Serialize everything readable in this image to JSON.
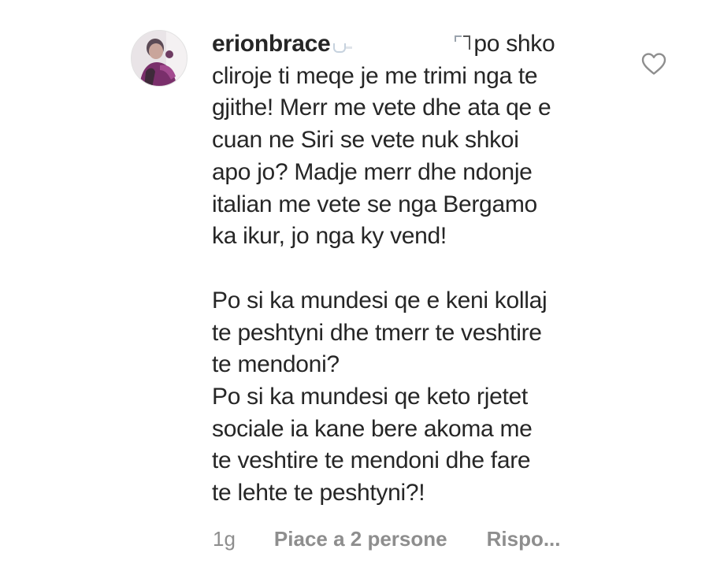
{
  "comment": {
    "username": "erionbrace",
    "mention_tail": "po shko",
    "paragraph1": "cliroje ti meqe je me trimi nga te\ngjithe! Merr me vete dhe ata qe e\ncuan ne Siri se vete nuk shkoi\napo jo? Madje merr dhe ndonje\nitalian me vete se nga Bergamo\nka ikur, jo nga ky vend!",
    "paragraph2": "Po si ka mundesi qe e keni kollaj\nte peshtyni dhe tmerr te veshtire\nte mendoni?\nPo si ka mundesi qe keto rjetet\nsociale ia kane bere akoma me\nte veshtire te mendoni dhe fare\nte lehte te peshtyni?!"
  },
  "meta": {
    "time": "1g",
    "likes": "Piace a 2 persone",
    "reply": "Rispo..."
  },
  "icons": {
    "like": "heart-outline-icon",
    "avatar": "profile-photo"
  },
  "colors": {
    "text": "#262626",
    "secondary": "#8e8e8e",
    "heart_stroke": "#8e8e8e"
  }
}
